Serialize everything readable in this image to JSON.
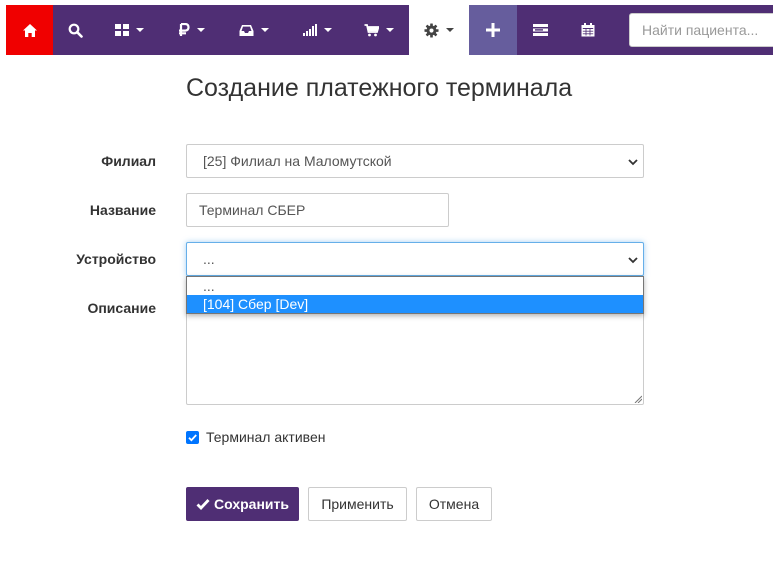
{
  "nav": {
    "items": [
      {
        "icon": "home-icon"
      },
      {
        "icon": "search-icon"
      },
      {
        "icon": "modules-icon"
      },
      {
        "icon": "ruble-icon"
      },
      {
        "icon": "inbox-icon"
      },
      {
        "icon": "bar-chart-icon"
      },
      {
        "icon": "cart-icon"
      },
      {
        "icon": "gear-icon"
      },
      {
        "icon": "plus-icon"
      },
      {
        "icon": "list-icon"
      },
      {
        "icon": "calendar-icon"
      }
    ],
    "patient_search_placeholder": "Найти пациента...",
    "colors": {
      "bar": "#4f2e74",
      "home": "#f00000",
      "add": "#665d9d"
    }
  },
  "page": {
    "title": "Создание платежного терминала"
  },
  "form": {
    "branch": {
      "label": "Филиал",
      "value": "[25] Филиал на Маломутской"
    },
    "name": {
      "label": "Название",
      "value": "Терминал СБЕР"
    },
    "device": {
      "label": "Устройство",
      "value": "...",
      "options": [
        "...",
        "[104] Сбер [Dev]"
      ],
      "highlighted_option": "[104] Сбер [Dev]"
    },
    "description": {
      "label": "Описание",
      "value": ""
    },
    "active": {
      "label": "Терминал активен",
      "checked": true
    }
  },
  "buttons": {
    "save": "Сохранить",
    "apply": "Применить",
    "cancel": "Отмена"
  }
}
